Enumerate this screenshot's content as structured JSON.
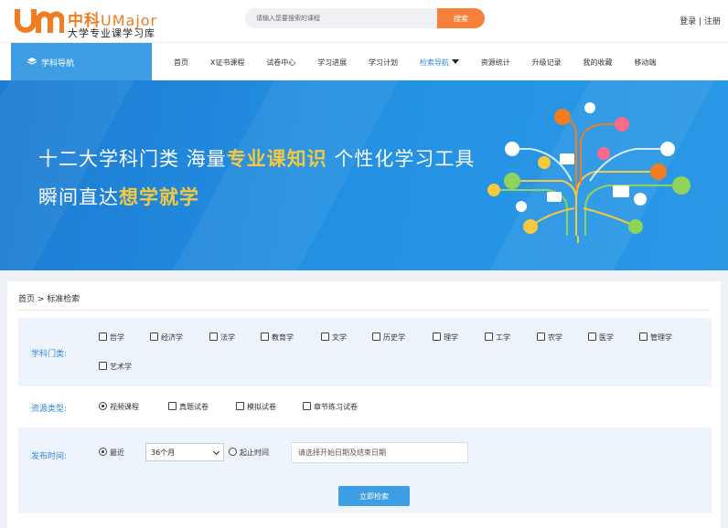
{
  "header": {
    "logo_cn": "中科",
    "logo_en": "UMajor",
    "logo_sub": "大学专业课学习库",
    "search_placeholder": "请输入您要搜索的课程",
    "search_button": "搜索",
    "login": "登录",
    "separator": "|",
    "register": "注册"
  },
  "nav": {
    "subject_nav": "学科导航",
    "items": [
      "首页",
      "X证书课程",
      "试卷中心",
      "学习进展",
      "学习计划",
      "检索导航",
      "资源统计",
      "升级记录",
      "我的收藏",
      "移动端"
    ],
    "active_index": 5
  },
  "banner": {
    "line1_a": "十二大学科门类 海量",
    "line1_hl": "专业课知识",
    "line1_b": " 个性化学习工具",
    "line2_a": "瞬间直达",
    "line2_hl": "想学就学"
  },
  "search": {
    "breadcrumb": "首页 > 标准检索",
    "subject_label": "学科门类:",
    "subjects": [
      "哲学",
      "经济学",
      "法学",
      "教育学",
      "文学",
      "历史学",
      "理学",
      "工学",
      "农学",
      "医学",
      "管理学",
      "艺术学"
    ],
    "resource_label": "资源类型:",
    "resources": [
      "视频课程",
      "真题试卷",
      "模拟试卷",
      "章节练习试卷"
    ],
    "time_label": "发布时间:",
    "recent_label": "最近",
    "recent_value": "36个月",
    "range_label": "起止时间",
    "date_placeholder": "请选择开始日期及结束日期",
    "submit": "立即检索"
  },
  "colors": {
    "accent_orange": "#f7803a",
    "accent_blue": "#3f9ee3",
    "highlight_yellow": "#f5c93e"
  }
}
